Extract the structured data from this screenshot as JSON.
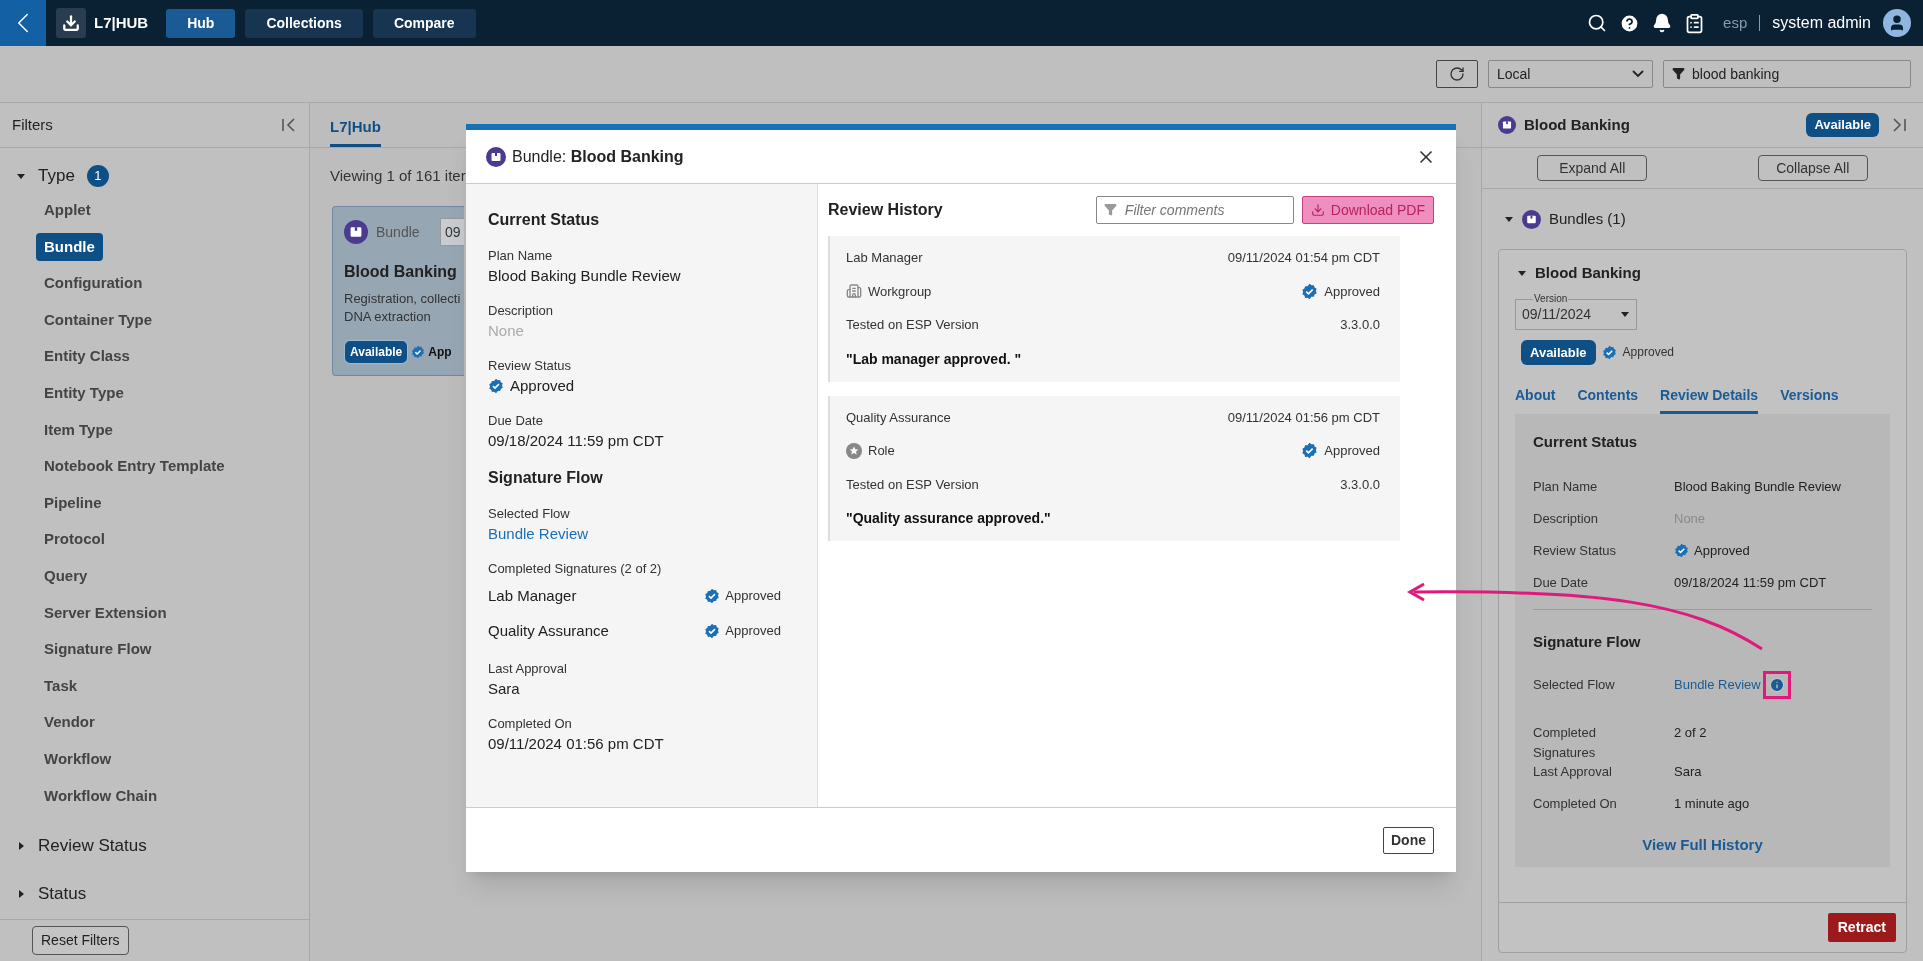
{
  "app_bar": {
    "logo": "L7|HUB",
    "nav": [
      {
        "label": "Hub",
        "selected": true
      },
      {
        "label": "Collections",
        "selected": false
      },
      {
        "label": "Compare",
        "selected": false
      }
    ],
    "user_prefix": "esp",
    "user": "system admin"
  },
  "toolbar": {
    "scope": "Local",
    "search": "blood banking"
  },
  "filters": {
    "title": "Filters",
    "groups": [
      {
        "label": "Type",
        "count": "1",
        "expanded": true,
        "items": [
          {
            "label": "Applet",
            "selected": false
          },
          {
            "label": "Bundle",
            "selected": true
          },
          {
            "label": "Configuration",
            "selected": false
          },
          {
            "label": "Container Type",
            "selected": false
          },
          {
            "label": "Entity Class",
            "selected": false
          },
          {
            "label": "Entity Type",
            "selected": false
          },
          {
            "label": "Item Type",
            "selected": false
          },
          {
            "label": "Notebook Entry Template",
            "selected": false
          },
          {
            "label": "Pipeline",
            "selected": false
          },
          {
            "label": "Protocol",
            "selected": false
          },
          {
            "label": "Query",
            "selected": false
          },
          {
            "label": "Server Extension",
            "selected": false
          },
          {
            "label": "Signature Flow",
            "selected": false
          },
          {
            "label": "Task",
            "selected": false
          },
          {
            "label": "Vendor",
            "selected": false
          },
          {
            "label": "Workflow",
            "selected": false
          },
          {
            "label": "Workflow Chain",
            "selected": false
          }
        ]
      },
      {
        "label": "Review Status",
        "expanded": false
      },
      {
        "label": "Status",
        "expanded": false
      }
    ],
    "reset": "Reset Filters"
  },
  "main": {
    "tab": "L7|Hub",
    "viewing": "Viewing 1 of 161 iter",
    "card": {
      "type": "Bundle",
      "version": "09",
      "title": "Blood Banking",
      "description": [
        "Registration, collecti",
        "DNA extraction"
      ],
      "badge": "Available",
      "status": "App"
    }
  },
  "modal": {
    "title": "Bundle: **Blood Banking**",
    "sections": [
      {
        "title": "Current Status",
        "items": [
          {
            "kind": "text",
            "label": "Plan Name",
            "value": "Blood Baking Bundle Review"
          },
          {
            "kind": "muted",
            "label": "Description",
            "value": "None"
          },
          {
            "kind": "status",
            "label": "Review Status",
            "value": "Approved"
          },
          {
            "kind": "text",
            "label": "Due Date",
            "value": "09/18/2024 11:59 pm CDT"
          }
        ]
      },
      {
        "title": "Signature Flow",
        "items": [
          {
            "kind": "link",
            "label": "Selected Flow",
            "value": "Bundle Review"
          },
          {
            "kind": "signatures",
            "label": "Completed Signatures (2 of 2)",
            "signatures": [
              {
                "name": "Lab Manager",
                "status": "Approved"
              },
              {
                "name": "Quality Assurance",
                "status": "Approved"
              }
            ]
          },
          {
            "kind": "text",
            "label": "Last Approval",
            "value": "Sara"
          },
          {
            "kind": "text",
            "label": "Completed On",
            "value": "09/11/2024 01:56 pm CDT"
          }
        ]
      }
    ],
    "history_title": "Review History",
    "filter_placeholder": "Filter comments",
    "download": "Download PDF",
    "history": [
      {
        "role": "Lab Manager",
        "time": "09/11/2024 01:54 pm CDT",
        "kind": "workgroup",
        "assignee": "Workgroup",
        "status": "Approved",
        "version_label": "Tested on ESP Version",
        "version": "3.3.0.0",
        "comment": "\"Lab manager approved. \""
      },
      {
        "role": "Quality Assurance",
        "time": "09/11/2024 01:56 pm CDT",
        "kind": "role",
        "assignee": "Role",
        "status": "Approved",
        "version_label": "Tested on ESP Version",
        "version": "3.3.0.0",
        "comment": "\"Quality assurance approved.\""
      }
    ],
    "done": "Done"
  },
  "panel": {
    "title": "Blood Banking",
    "badge": "Available",
    "expand_all": "Expand All",
    "collapse_all": "Collapse All",
    "group": "Bundles (1)",
    "group_expanded": true,
    "item": "Blood Banking",
    "item_expanded": true,
    "version_label": "Version",
    "version": "09/11/2024",
    "item_badge": "Available",
    "item_status": "Approved",
    "tabs": [
      {
        "label": "About",
        "selected": false
      },
      {
        "label": "Contents",
        "selected": false
      },
      {
        "label": "Review Details",
        "selected": true
      },
      {
        "label": "Versions",
        "selected": false
      }
    ],
    "sections": [
      {
        "title": "Current Status",
        "rows": [
          {
            "kind": "text",
            "label": "Plan Name",
            "value": "Blood Baking Bundle Review"
          },
          {
            "kind": "muted",
            "label": "Description",
            "value": "None"
          },
          {
            "kind": "status",
            "label": "Review Status",
            "value": "Approved"
          },
          {
            "kind": "text",
            "label": "Due Date",
            "value": "09/18/2024 11:59 pm CDT"
          }
        ]
      },
      {
        "title": "Signature Flow",
        "rows": [
          {
            "kind": "link_info",
            "label": "Selected Flow",
            "value": "Bundle Review",
            "highlighted": true
          },
          {
            "kind": "text",
            "label": "Completed Signatures",
            "value": "2 of 2"
          },
          {
            "kind": "text",
            "label": "Last Approval",
            "value": "Sara"
          },
          {
            "kind": "text",
            "label": "Completed On",
            "value": "1 minute ago"
          }
        ]
      }
    ],
    "history_link": "View Full History",
    "retract": "Retract"
  }
}
